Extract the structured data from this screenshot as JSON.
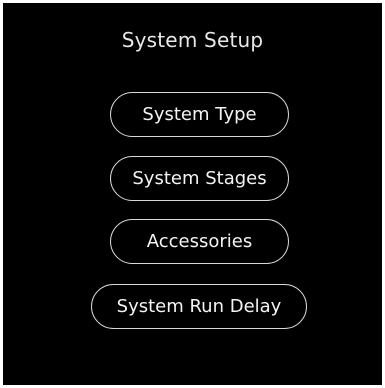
{
  "screen": {
    "title": "System Setup",
    "menu": {
      "system_type": "System Type",
      "system_stages": "System Stages",
      "accessories": "Accessories",
      "system_run_delay": "System Run Delay"
    }
  },
  "colors": {
    "background": "#000000",
    "text": "#f4f4f4",
    "button_border": "#d9d9d9",
    "frame": "#ffffff"
  }
}
